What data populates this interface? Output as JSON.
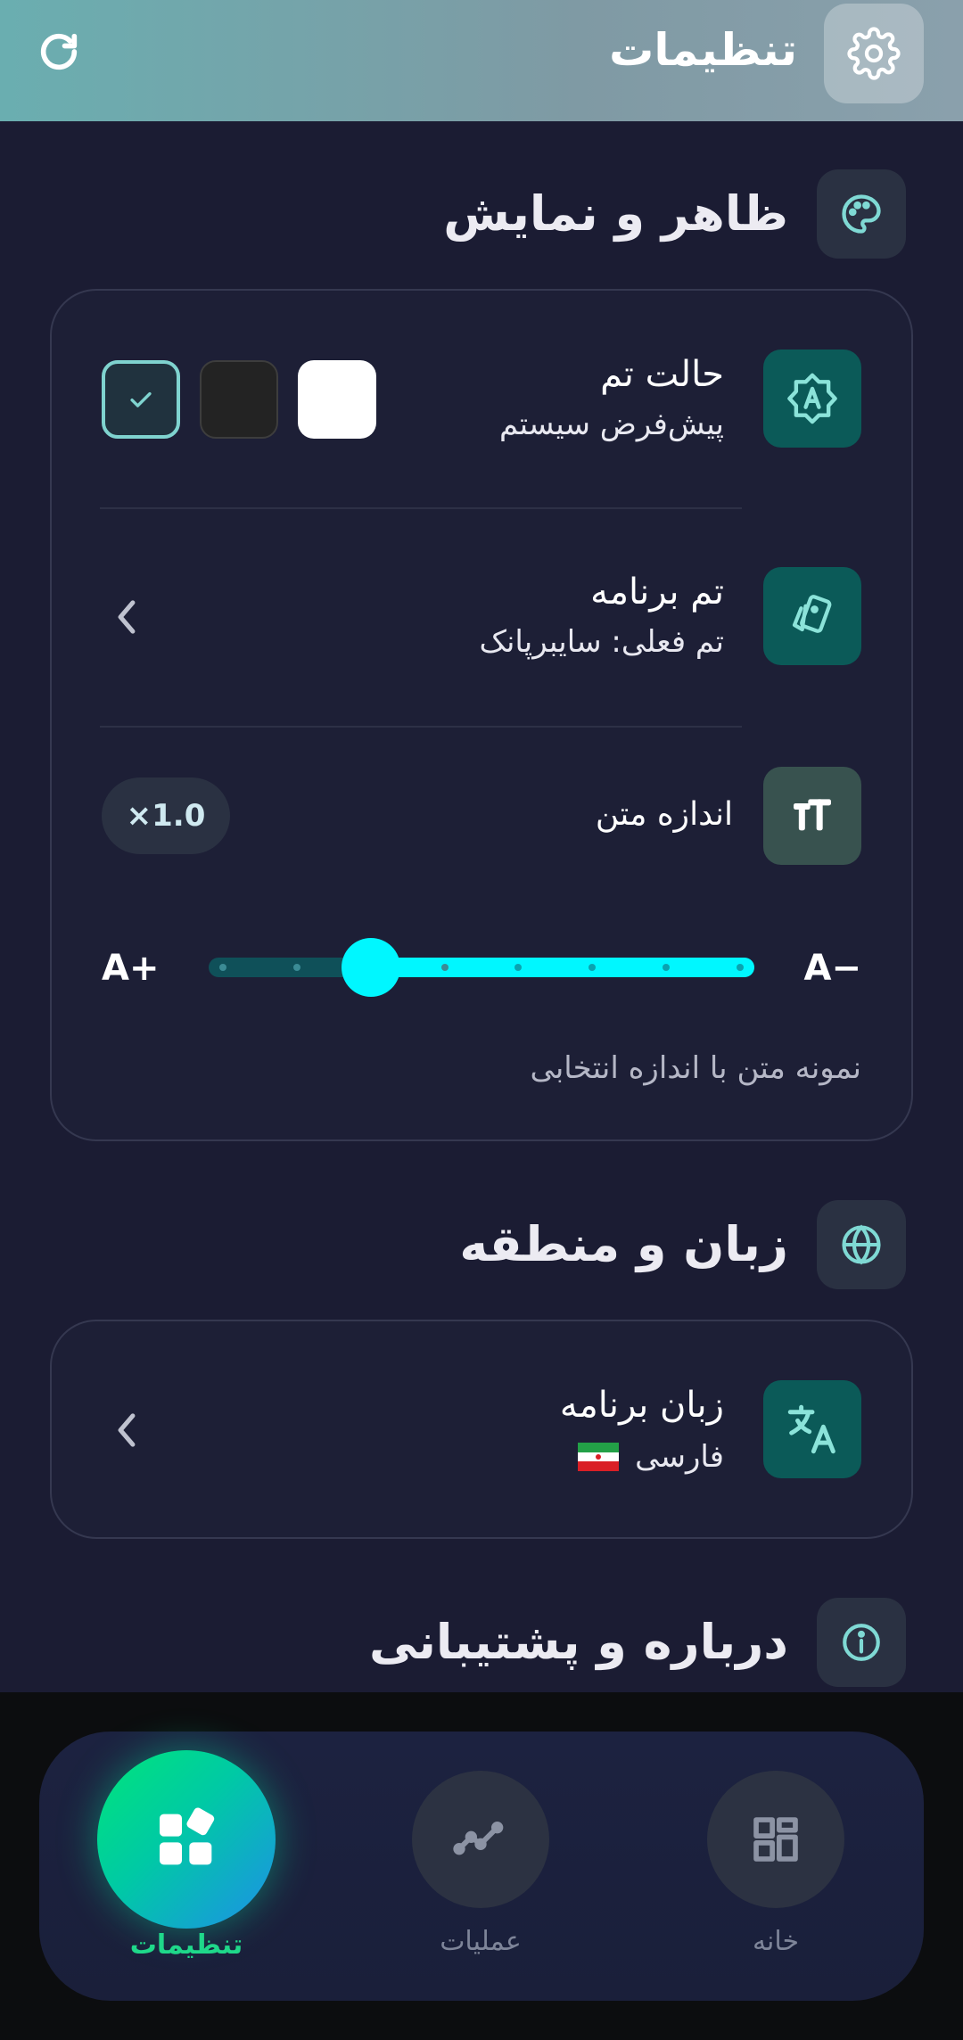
{
  "header": {
    "title": "تنظیمات",
    "gear_icon": "gear-icon",
    "refresh_icon": "refresh-icon"
  },
  "appearance": {
    "title": "ظاهر و نمایش",
    "icon": "palette-icon",
    "theme_mode": {
      "title": "حالت تم",
      "subtitle": "پیش‌فرض سیستم",
      "options": [
        "light",
        "dark",
        "system"
      ],
      "selected": "system"
    },
    "app_theme": {
      "title": "تم برنامه",
      "subtitle": "تم فعلی: سایبرپانک"
    },
    "text_size": {
      "title": "اندازه متن",
      "scale": "×1.0",
      "min_label": "A−",
      "max_label": "A+",
      "steps": 8,
      "selected_step_from_right": 3,
      "sample": "نمونه متن با اندازه انتخابی"
    }
  },
  "language": {
    "title": "زبان و منطقه",
    "icon": "globe-icon",
    "app_language": {
      "title": "زبان برنامه",
      "value": "فارسی",
      "flag": "🇮🇷"
    }
  },
  "about": {
    "title": "درباره و پشتیبانی",
    "icon": "info-icon"
  },
  "nav": {
    "items": [
      {
        "label": "خانه",
        "icon": "dashboard-icon",
        "active": false
      },
      {
        "label": "عملیات",
        "icon": "trend-line-icon",
        "active": false
      },
      {
        "label": "تنظیمات",
        "icon": "apps-icon",
        "active": true
      }
    ]
  },
  "colors": {
    "accent": "#00f7ff",
    "active_nav_label": "#1fd88a",
    "background": "#1b1c33"
  }
}
